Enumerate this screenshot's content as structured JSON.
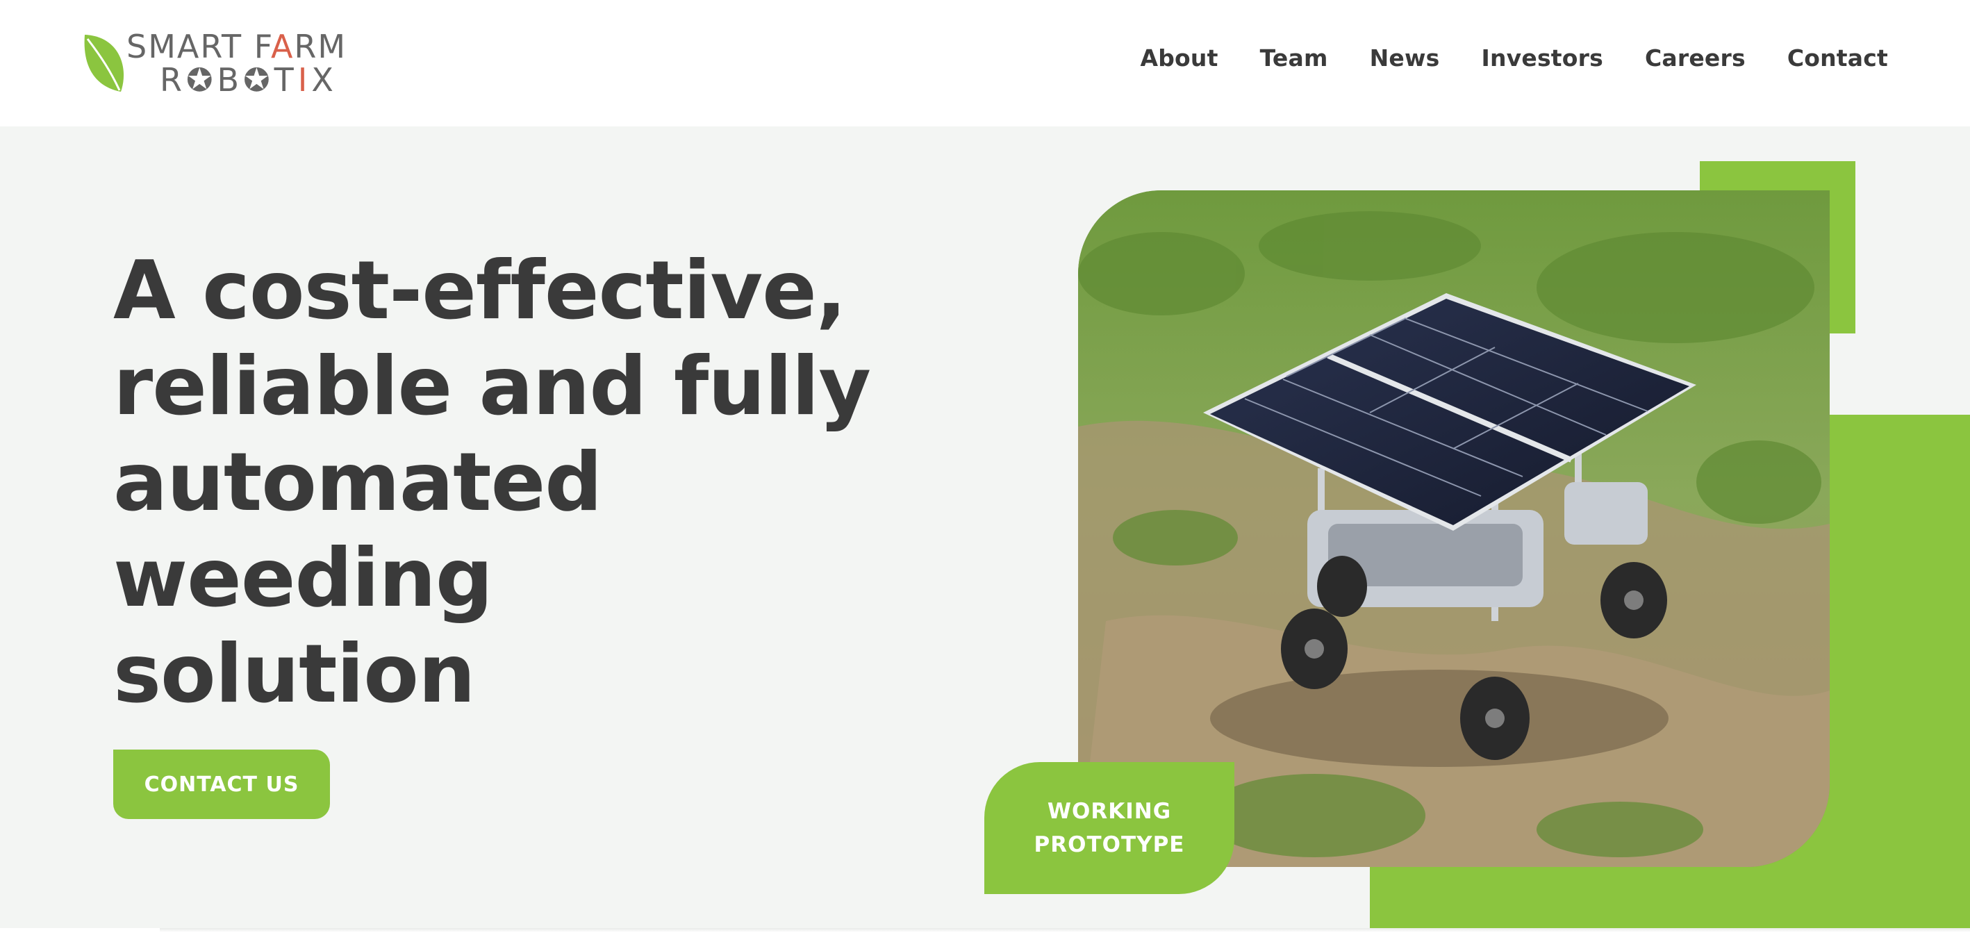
{
  "brand": {
    "line1_a": "SMART F",
    "line1_accent": "A",
    "line1_b": "RM",
    "line2_a": "R",
    "line2_cog1": "✪",
    "line2_b": "B",
    "line2_cog2": "✪",
    "line2_c": "T",
    "line2_accent": "I",
    "line2_d": "X",
    "leaf_icon": "leaf-icon",
    "leaf_color": "#8bc53f",
    "accent_color": "#d9604a"
  },
  "nav": {
    "items": [
      "About",
      "Team",
      "News",
      "Investors",
      "Careers",
      "Contact"
    ]
  },
  "hero": {
    "headline_lines": [
      "A cost-effective,",
      "reliable and fully",
      "automated",
      "weeding",
      "solution"
    ],
    "cta_label": "CONTACT US",
    "badge_line1": "WORKING",
    "badge_line2": "PROTOTYPE",
    "image_subject": "solar-powered weeding robot on grassy field"
  },
  "colors": {
    "brand_green": "#8bc53f",
    "text_dark": "#3a3a3a",
    "hero_bg": "#f3f5f3"
  }
}
